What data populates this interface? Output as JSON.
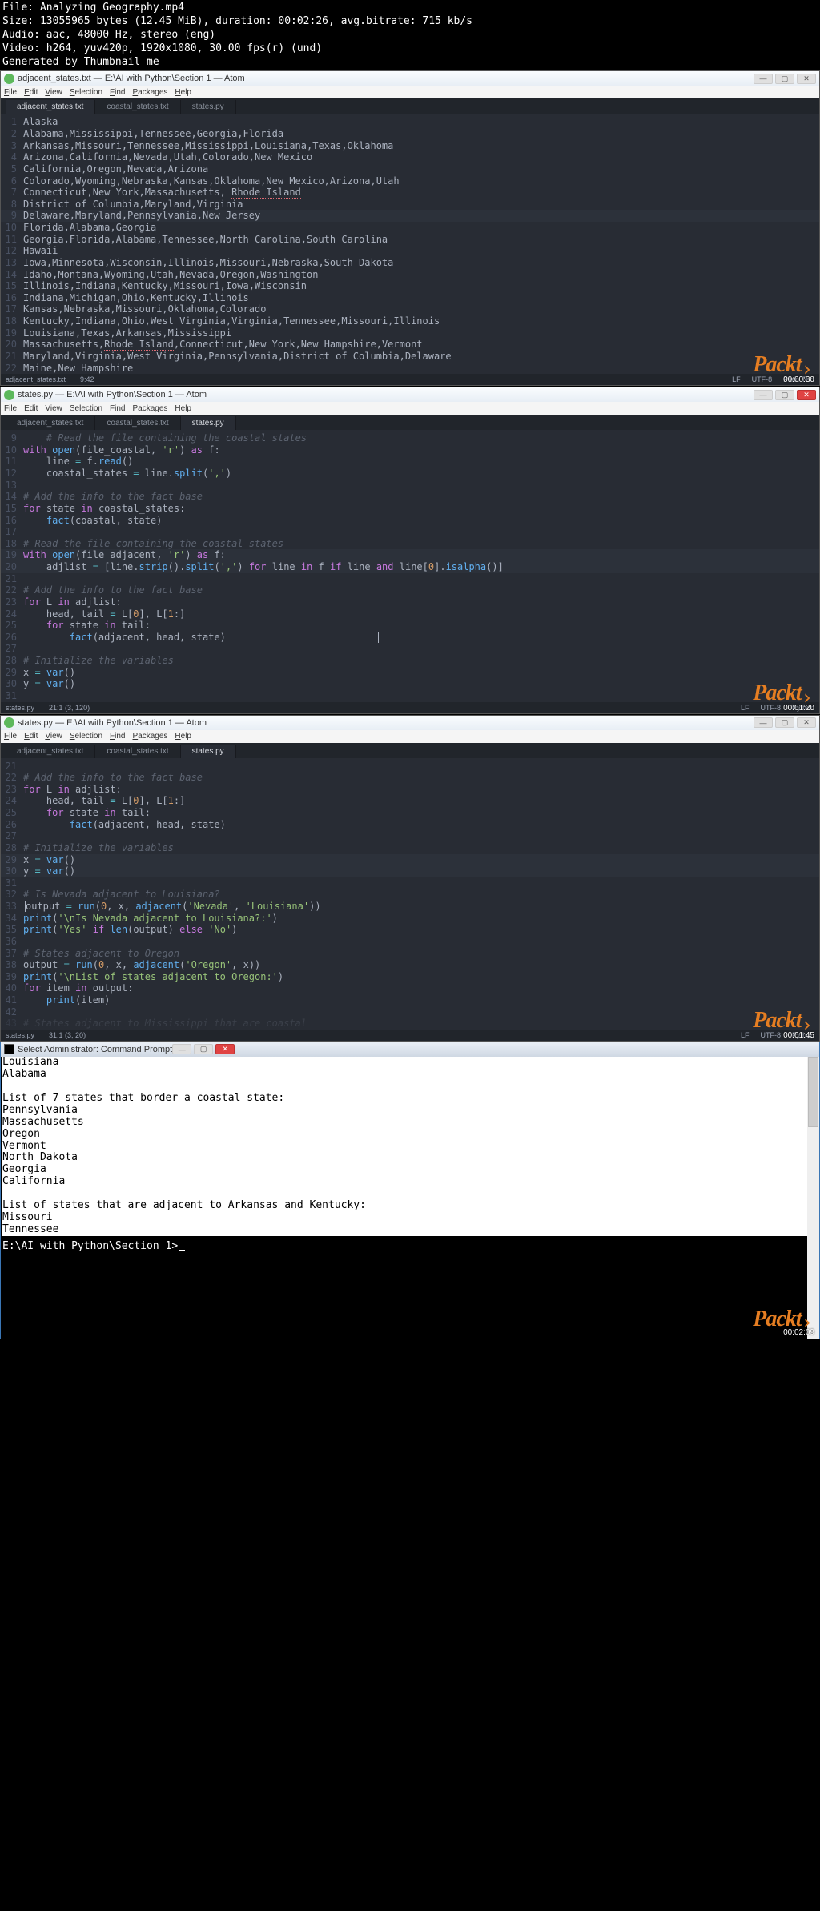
{
  "meta": {
    "file": "File: Analyzing Geography.mp4",
    "size": "Size: 13055965 bytes (12.45 MiB), duration: 00:02:26, avg.bitrate: 715 kb/s",
    "audio": "Audio: aac, 48000 Hz, stereo (eng)",
    "video": "Video: h264, yuv420p, 1920x1080, 30.00 fps(r) (und)",
    "gen": "Generated by Thumbnail me"
  },
  "menu": [
    "File",
    "Edit",
    "View",
    "Selection",
    "Find",
    "Packages",
    "Help"
  ],
  "watermark": "Packt",
  "frames": [
    {
      "title": "adjacent_states.txt — E:\\AI with Python\\Section 1 — Atom",
      "tabs": [
        {
          "label": "adjacent_states.txt",
          "active": true
        },
        {
          "label": "coastal_states.txt",
          "active": false
        },
        {
          "label": "states.py",
          "active": false
        }
      ],
      "status_left": "adjacent_states.txt",
      "status_mid": "9:42",
      "status_right": [
        "LF",
        "UTF-8",
        "Plain Text"
      ],
      "timestamp": "00:00:30",
      "hl": 9,
      "lines": [
        [
          1,
          "Alaska"
        ],
        [
          2,
          "Alabama,Mississippi,Tennessee,Georgia,Florida"
        ],
        [
          3,
          "Arkansas,Missouri,Tennessee,Mississippi,Louisiana,Texas,Oklahoma"
        ],
        [
          4,
          "Arizona,California,Nevada,Utah,Colorado,New Mexico"
        ],
        [
          5,
          "California,Oregon,Nevada,Arizona"
        ],
        [
          6,
          "Colorado,Wyoming,Nebraska,Kansas,Oklahoma,New Mexico,Arizona,Utah"
        ],
        [
          7,
          "Connecticut,New York,Massachusetts, Rhode Island",
          "squiggle_last"
        ],
        [
          8,
          "District of Columbia,Maryland,Virginia"
        ],
        [
          9,
          "Delaware,Maryland,Pennsylvania,New Jersey"
        ],
        [
          10,
          "Florida,Alabama,Georgia"
        ],
        [
          11,
          "Georgia,Florida,Alabama,Tennessee,North Carolina,South Carolina"
        ],
        [
          12,
          "Hawaii"
        ],
        [
          13,
          "Iowa,Minnesota,Wisconsin,Illinois,Missouri,Nebraska,South Dakota"
        ],
        [
          14,
          "Idaho,Montana,Wyoming,Utah,Nevada,Oregon,Washington"
        ],
        [
          15,
          "Illinois,Indiana,Kentucky,Missouri,Iowa,Wisconsin"
        ],
        [
          16,
          "Indiana,Michigan,Ohio,Kentucky,Illinois"
        ],
        [
          17,
          "Kansas,Nebraska,Missouri,Oklahoma,Colorado"
        ],
        [
          18,
          "Kentucky,Indiana,Ohio,West Virginia,Virginia,Tennessee,Missouri,Illinois"
        ],
        [
          19,
          "Louisiana,Texas,Arkansas,Mississippi"
        ],
        [
          20,
          "Massachusetts,Rhode Island,Connecticut,New York,New Hampshire,Vermont",
          "squiggle_second"
        ],
        [
          21,
          "Maryland,Virginia,West Virginia,Pennsylvania,District of Columbia,Delaware"
        ],
        [
          22,
          "Maine,New Hampshire"
        ]
      ]
    },
    {
      "title": "states.py — E:\\AI with Python\\Section 1 — Atom",
      "tabs": [
        {
          "label": "adjacent_states.txt",
          "active": false
        },
        {
          "label": "coastal_states.txt",
          "active": false
        },
        {
          "label": "states.py",
          "active": true
        }
      ],
      "status_left": "states.py",
      "status_mid": "21:1    (3, 120)",
      "status_right": [
        "LF",
        "UTF-8",
        "Python"
      ],
      "timestamp": "00:01:20",
      "hl_range": [
        19,
        20
      ],
      "close_red": true,
      "code": [
        {
          "n": 9,
          "html": "    <span class='cmt'># Read the file containing the coastal states</span>"
        },
        {
          "n": 10,
          "html": "<span class='kw'>with</span> <span class='fn'>open</span>(file_coastal, <span class='str'>'r'</span>) <span class='kw'>as</span> f:"
        },
        {
          "n": 11,
          "html": "    line <span class='op'>=</span> f.<span class='fn'>read</span>()"
        },
        {
          "n": 12,
          "html": "    coastal_states <span class='op'>=</span> line.<span class='fn'>split</span>(<span class='str'>','</span>)"
        },
        {
          "n": 13,
          "html": ""
        },
        {
          "n": 14,
          "html": "<span class='cmt'># Add the info to the fact base</span>"
        },
        {
          "n": 15,
          "html": "<span class='kw'>for</span> state <span class='kw'>in</span> coastal_states:"
        },
        {
          "n": 16,
          "html": "    <span class='fn'>fact</span>(coastal, state)"
        },
        {
          "n": 17,
          "html": ""
        },
        {
          "n": 18,
          "html": "<span class='cmt'># Read the file containing the coastal states</span>"
        },
        {
          "n": 19,
          "html": "<span class='kw'>with</span> <span class='fn'>open</span>(file_adjacent, <span class='str'>'r'</span>) <span class='kw'>as</span> f:"
        },
        {
          "n": 20,
          "html": "    adjlist <span class='op'>=</span> [line.<span class='fn'>strip</span>().<span class='fn'>split</span>(<span class='str'>','</span>) <span class='kw'>for</span> line <span class='kw'>in</span> f <span class='kw'>if</span> line <span class='kw'>and</span> line[<span class='num'>0</span>].<span class='fn'>isalpha</span>()]"
        },
        {
          "n": 21,
          "html": ""
        },
        {
          "n": 22,
          "html": "<span class='cmt'># Add the info to the fact base</span>"
        },
        {
          "n": 23,
          "html": "<span class='kw'>for</span> L <span class='kw'>in</span> adjlist:"
        },
        {
          "n": 24,
          "html": "    head, tail <span class='op'>=</span> L[<span class='num'>0</span>], L[<span class='num'>1</span>:]"
        },
        {
          "n": 25,
          "html": "    <span class='kw'>for</span> state <span class='kw'>in</span> tail:"
        },
        {
          "n": 26,
          "html": "        <span class='fn'>fact</span>(adjacent, head, state)                          <span class='caret'></span>"
        },
        {
          "n": 27,
          "html": ""
        },
        {
          "n": 28,
          "html": "<span class='cmt'># Initialize the variables</span>"
        },
        {
          "n": 29,
          "html": "x <span class='op'>=</span> <span class='fn'>var</span>()"
        },
        {
          "n": 30,
          "html": "y <span class='op'>=</span> <span class='fn'>var</span>()"
        },
        {
          "n": 31,
          "html": ""
        }
      ]
    },
    {
      "title": "states.py — E:\\AI with Python\\Section 1 — Atom",
      "tabs": [
        {
          "label": "adjacent_states.txt",
          "active": false
        },
        {
          "label": "coastal_states.txt",
          "active": false
        },
        {
          "label": "states.py",
          "active": true
        }
      ],
      "status_left": "states.py",
      "status_mid": "31:1    (3, 20)",
      "status_right": [
        "LF",
        "UTF-8",
        "Python"
      ],
      "timestamp": "00:01:45",
      "hl_range": [
        29,
        30
      ],
      "code": [
        {
          "n": 21,
          "html": ""
        },
        {
          "n": 22,
          "html": "<span class='cmt'># Add the info to the fact base</span>"
        },
        {
          "n": 23,
          "html": "<span class='kw'>for</span> L <span class='kw'>in</span> adjlist:"
        },
        {
          "n": 24,
          "html": "    head, tail <span class='op'>=</span> L[<span class='num'>0</span>], L[<span class='num'>1</span>:]"
        },
        {
          "n": 25,
          "html": "    <span class='kw'>for</span> state <span class='kw'>in</span> tail:"
        },
        {
          "n": 26,
          "html": "        <span class='fn'>fact</span>(adjacent, head, state)"
        },
        {
          "n": 27,
          "html": ""
        },
        {
          "n": 28,
          "html": "<span class='cmt'># Initialize the variables</span>"
        },
        {
          "n": 29,
          "html": "x <span class='op'>=</span> <span class='fn'>var</span>()"
        },
        {
          "n": 30,
          "html": "y <span class='op'>=</span> <span class='fn'>var</span>()"
        },
        {
          "n": 31,
          "html": ""
        },
        {
          "n": 32,
          "html": "<span class='cmt'># Is Nevada adjacent to Louisiana?</span>"
        },
        {
          "n": 33,
          "html": "<span class='caret'></span>output <span class='op'>=</span> <span class='fn'>run</span>(<span class='num'>0</span>, x, <span class='fn'>adjacent</span>(<span class='str'>'Nevada'</span>, <span class='str'>'Louisiana'</span>))"
        },
        {
          "n": 34,
          "html": "<span class='fn'>print</span>(<span class='str'>'\\nIs Nevada adjacent to Louisiana?:'</span>)"
        },
        {
          "n": 35,
          "html": "<span class='fn'>print</span>(<span class='str'>'Yes'</span> <span class='kw'>if</span> <span class='fn'>len</span>(output) <span class='kw'>else</span> <span class='str'>'No'</span>)"
        },
        {
          "n": 36,
          "html": ""
        },
        {
          "n": 37,
          "html": "<span class='cmt'># States adjacent to Oregon</span>"
        },
        {
          "n": 38,
          "html": "output <span class='op'>=</span> <span class='fn'>run</span>(<span class='num'>0</span>, x, <span class='fn'>adjacent</span>(<span class='str'>'Oregon'</span>, x))"
        },
        {
          "n": 39,
          "html": "<span class='fn'>print</span>(<span class='str'>'\\nList of states adjacent to Oregon:'</span>)"
        },
        {
          "n": 40,
          "html": "<span class='kw'>for</span> item <span class='kw'>in</span> output:"
        },
        {
          "n": 41,
          "html": "    <span class='fn'>print</span>(item)"
        },
        {
          "n": 42,
          "html": ""
        },
        {
          "n": 43,
          "html": "<span class='cmt'># States adjacent to Mississippi that are coastal</span>",
          "dim": true
        }
      ]
    }
  ],
  "cmd": {
    "title": "Select Administrator: Command Prompt",
    "timestamp": "00:02:09",
    "white_lines": [
      "Louisiana",
      "Alabama",
      "",
      "List of 7 states that border a coastal state:",
      "Pennsylvania",
      "Massachusetts",
      "Oregon",
      "Vermont",
      "North Dakota",
      "Georgia",
      "California",
      "",
      "List of states that are adjacent to Arkansas and Kentucky:",
      "Missouri",
      "Tennessee"
    ],
    "prompt": "E:\\AI with Python\\Section 1>"
  }
}
